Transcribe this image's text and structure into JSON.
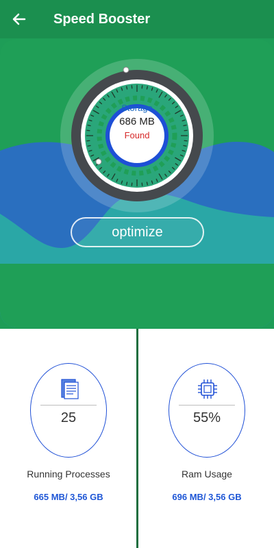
{
  "app_bar": {
    "title": "Speed Booster"
  },
  "storage": {
    "label": "Storage",
    "value": "686 MB",
    "status": "Found"
  },
  "optimize_button": {
    "label": "optimize"
  },
  "stats": [
    {
      "number": "25",
      "label": "Running Processes",
      "memory": "665 MB/ 3,56 GB",
      "icon": "document-icon"
    },
    {
      "number": "55%",
      "label": "Ram Usage",
      "memory": "696 MB/ 3,56 GB",
      "icon": "cpu-chip-icon"
    }
  ],
  "colors": {
    "primary_green": "#1e9d57",
    "wave_blue": "#2a6fbf",
    "wave_teal": "#2aa7a6",
    "accent_blue": "#1e4fd6",
    "found_red": "#d62828"
  }
}
